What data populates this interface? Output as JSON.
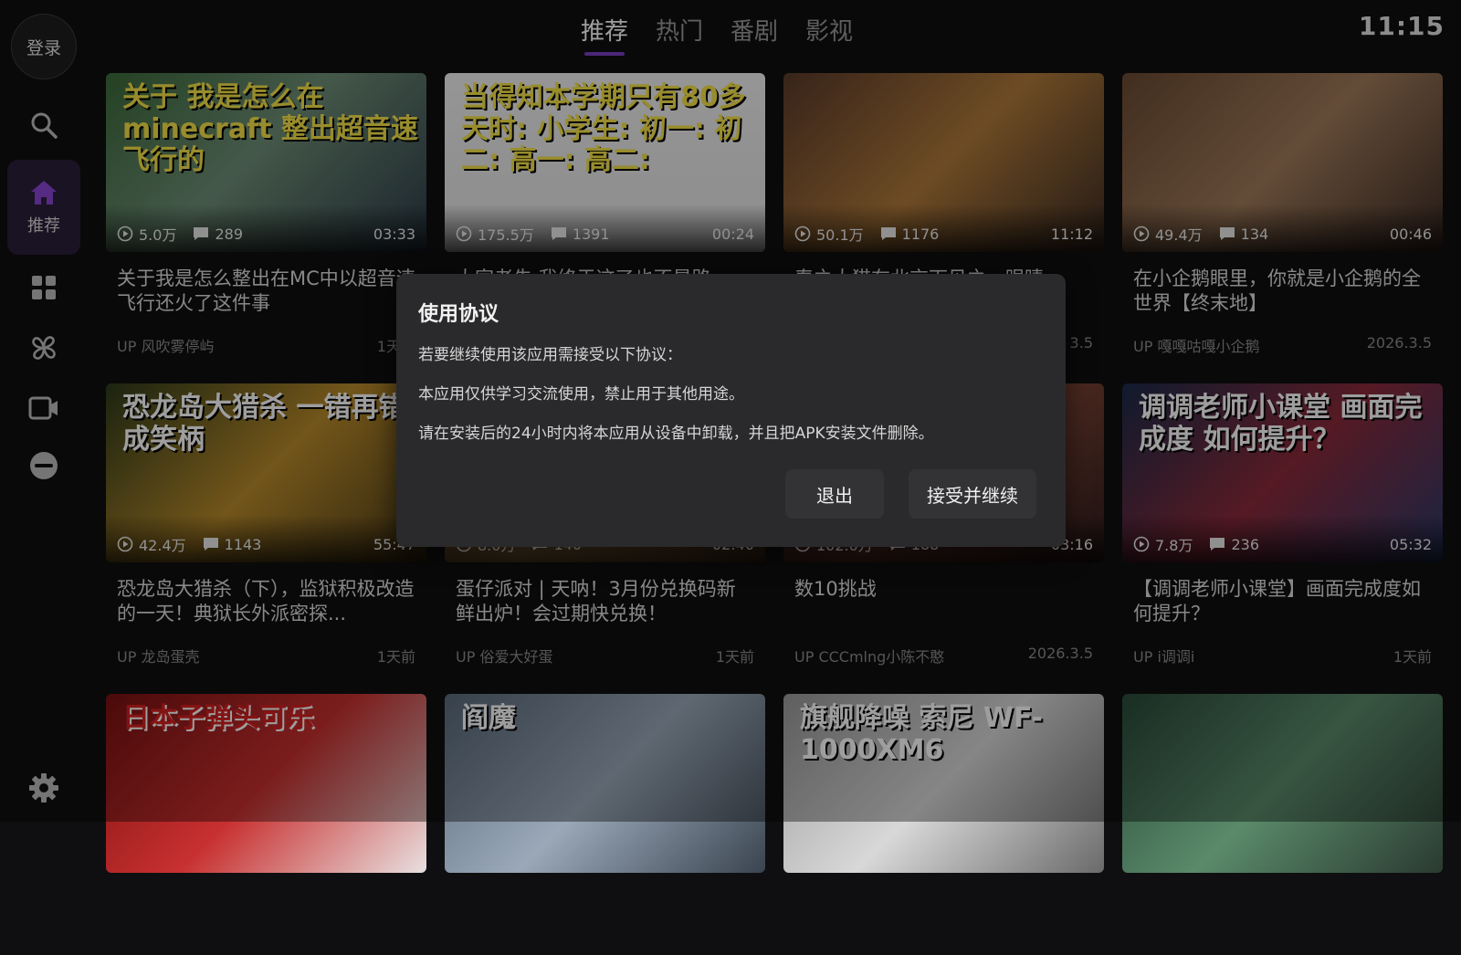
{
  "sidebar": {
    "login_label": "登录",
    "items": [
      {
        "icon": "search-icon"
      },
      {
        "icon": "home-icon",
        "label": "推荐",
        "active": true
      },
      {
        "icon": "grid-icon"
      },
      {
        "icon": "pinwheel-icon"
      },
      {
        "icon": "video-icon"
      },
      {
        "icon": "face-icon"
      },
      {
        "icon": "gear-icon"
      }
    ]
  },
  "tabs": [
    "推荐",
    "热门",
    "番剧",
    "影视"
  ],
  "active_tab": "推荐",
  "clock": "11:15",
  "accent_color": "#7b3fc4",
  "cards": [
    {
      "title": "关于我是怎么整出在MC中以超音速飞行还火了这件事",
      "author": "UP 风吹雾停屿",
      "date": "1天前",
      "views": "5.0万",
      "comments": "289",
      "duration": "03:33",
      "thumb_text": "关于 我是怎么在 minecraft 整出超音速飞行的"
    },
    {
      "title": "大家老先 我终于这了也不是路",
      "author": "",
      "date": "",
      "views": "175.5万",
      "comments": "1391",
      "duration": "00:24",
      "thumb_text": "当得知本学期只有80多天时: 小学生: 初一: 初二: 高一: 高二:"
    },
    {
      "title": "春之大猫在北京下见之一眼睛一",
      "author": "",
      "date": "3.5",
      "views": "50.1万",
      "comments": "1176",
      "duration": "11:12",
      "thumb_text": ""
    },
    {
      "title": "在小企鹅眼里，你就是小企鹅的全世界【终末地】",
      "author": "UP 嘎嘎咕嘎小企鹅",
      "date": "2026.3.5",
      "views": "49.4万",
      "comments": "134",
      "duration": "00:46",
      "thumb_text": ""
    },
    {
      "title": "恐龙岛大猎杀（下），监狱积极改造的一天！典狱长外派密探...",
      "author": "UP 龙岛蛋壳",
      "date": "1天前",
      "views": "42.4万",
      "comments": "1143",
      "duration": "55:47",
      "thumb_text": "恐龙岛大猎杀 一错再错成笑柄"
    },
    {
      "title": "蛋仔派对 | 天呐！3月份兑换码新鲜出炉！会过期快兑换！",
      "author": "UP 俗爱大好蛋",
      "date": "1天前",
      "views": "8.0万",
      "comments": "140",
      "duration": "02:40",
      "thumb_text": ""
    },
    {
      "title": "数10挑战",
      "author": "UP CCCmlng小陈不憨",
      "date": "2026.3.5",
      "views": "102.0万",
      "comments": "188",
      "duration": "03:16",
      "thumb_text": ""
    },
    {
      "title": "【调调老师小课堂】画面完成度如何提升？",
      "author": "UP i调调i",
      "date": "1天前",
      "views": "7.8万",
      "comments": "236",
      "duration": "05:32",
      "thumb_text": "调调老师小课堂 画面完成度 如何提升？"
    },
    {
      "title": "",
      "author": "",
      "date": "",
      "views": "",
      "comments": "",
      "duration": "",
      "thumb_text": "日本子弹头可乐"
    },
    {
      "title": "",
      "author": "",
      "date": "",
      "views": "",
      "comments": "",
      "duration": "",
      "thumb_text": "阎魔"
    },
    {
      "title": "",
      "author": "",
      "date": "",
      "views": "",
      "comments": "",
      "duration": "",
      "thumb_text": "旗舰降噪 索尼 WF-1000XM6"
    },
    {
      "title": "",
      "author": "",
      "date": "",
      "views": "",
      "comments": "",
      "duration": "",
      "thumb_text": ""
    }
  ],
  "dialog": {
    "title": "使用协议",
    "line1": "若要继续使用该应用需接受以下协议：",
    "line2": "本应用仅供学习交流使用，禁止用于其他用途。",
    "line3": "请在安装后的24小时内将本应用从设备中卸载，并且把APK安装文件删除。",
    "exit_label": "退出",
    "accept_label": "接受并继续"
  }
}
